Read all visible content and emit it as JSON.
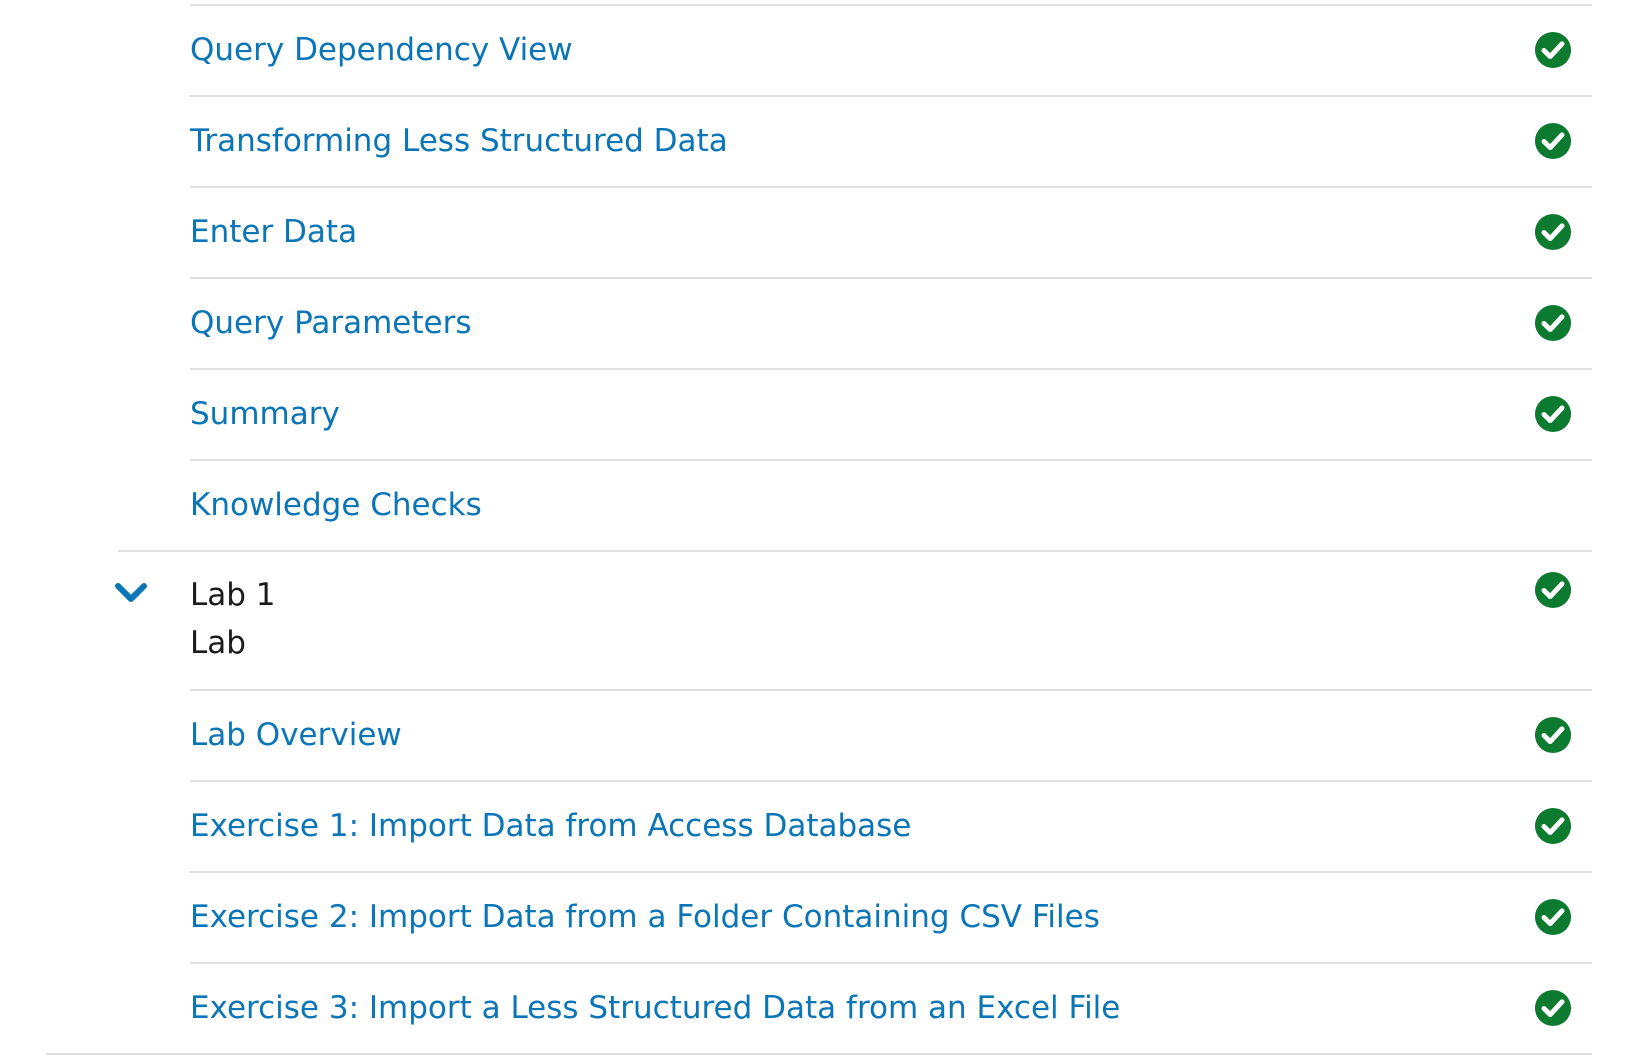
{
  "units": [
    {
      "label": "Query Dependency View",
      "completed": true
    },
    {
      "label": "Transforming Less Structured Data",
      "completed": true
    },
    {
      "label": "Enter Data",
      "completed": true
    },
    {
      "label": "Query Parameters",
      "completed": true
    },
    {
      "label": "Summary",
      "completed": true
    },
    {
      "label": "Knowledge Checks",
      "completed": false
    }
  ],
  "lab": {
    "title": "Lab 1",
    "subtitle": "Lab",
    "completed": true,
    "expanded": true,
    "units": [
      {
        "label": "Lab Overview",
        "completed": true
      },
      {
        "label": "Exercise 1: Import Data from Access Database",
        "completed": true
      },
      {
        "label": "Exercise 2: Import Data from a Folder Containing CSV Files",
        "completed": true
      },
      {
        "label": "Exercise 3: Import a Less Structured Data from an Excel File",
        "completed": true
      }
    ]
  },
  "icons": {
    "completed": "check-circle-icon",
    "expand": "chevron-down-icon"
  },
  "colors": {
    "link": "#0a75b7",
    "check": "#0d7b2f",
    "divider": "#e1e1e1",
    "text": "#1b1b1b"
  }
}
